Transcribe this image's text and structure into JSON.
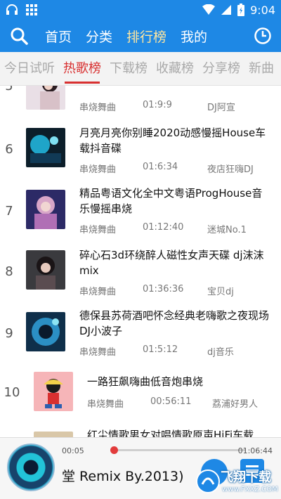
{
  "status_bar": {
    "time": "9:04",
    "accent": "#1e88e5"
  },
  "nav": {
    "items": [
      {
        "label": "首页",
        "active": false
      },
      {
        "label": "分类",
        "active": false
      },
      {
        "label": "排行榜",
        "active": true
      },
      {
        "label": "我的",
        "active": false
      }
    ],
    "search_icon": "search-icon",
    "history_icon": "clock-icon"
  },
  "tabs": [
    {
      "label": "今日试听",
      "active": false
    },
    {
      "label": "热歌榜",
      "active": true
    },
    {
      "label": "下载榜",
      "active": false
    },
    {
      "label": "收藏榜",
      "active": false
    },
    {
      "label": "分享榜",
      "active": false
    },
    {
      "label": "新曲",
      "active": false
    }
  ],
  "songs": [
    {
      "rank": "5",
      "title": "mix",
      "genre": "串烧舞曲",
      "duration": "01:9:9",
      "author": "DJ阿宣"
    },
    {
      "rank": "6",
      "title": "月亮月亮你别睡2020动感慢摇House车载抖音碟",
      "genre": "串烧舞曲",
      "duration": "01:6:34",
      "author": "夜店狂嗨DJ"
    },
    {
      "rank": "7",
      "title": "精品粤语文化全中文粤语ProgHouse音乐慢摇串烧",
      "genre": "串烧舞曲",
      "duration": "01:12:40",
      "author": "迷城No.1"
    },
    {
      "rank": "8",
      "title": "碎心石3d环绕醉人磁性女声天碟 dj沫沫mix",
      "genre": "串烧舞曲",
      "duration": "01:36:36",
      "author": "宝贝dj"
    },
    {
      "rank": "9",
      "title": "德保县苏荷酒吧怀念经典老嗨歌之夜现场DJ小波子",
      "genre": "串烧舞曲",
      "duration": "01:5:12",
      "author": "dj音乐"
    },
    {
      "rank": "10",
      "title": "一路狂飙嗨曲低音炮串烧",
      "genre": "串烧舞曲",
      "duration": "00:56:11",
      "author": "荔浦好男人"
    },
    {
      "rank": "",
      "title": "红尘情歌男女对唱情歌原声HiFi车载",
      "genre": "",
      "duration": "",
      "author": ""
    }
  ],
  "player": {
    "elapsed": "00:05",
    "total": "01:06:44",
    "progress_fraction": 0.01,
    "now_playing": "堂 Remix By.2013)"
  },
  "watermark": {
    "text": "飞翔下载",
    "url": "www.FXXZ.COM"
  }
}
